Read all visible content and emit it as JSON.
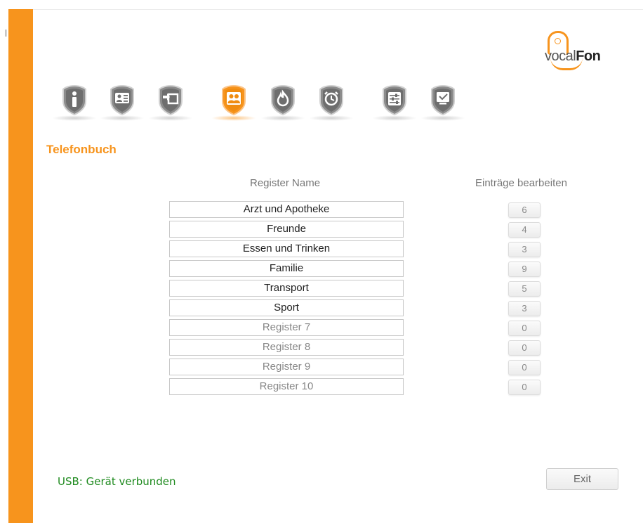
{
  "app": {
    "logo": {
      "text_light": "vocal",
      "text_bold": "Fon"
    },
    "accent_color": "#f7941d",
    "status_color": "#1e8a1e"
  },
  "nav": {
    "items": [
      {
        "icon": "info-icon",
        "active": false
      },
      {
        "icon": "contact-card-icon",
        "active": false
      },
      {
        "icon": "import-icon",
        "active": false
      },
      {
        "icon": "phonebook-icon",
        "active": true
      },
      {
        "icon": "emergency-icon",
        "active": false
      },
      {
        "icon": "alarm-clock-icon",
        "active": false
      },
      {
        "icon": "settings-sliders-icon",
        "active": false
      },
      {
        "icon": "display-icon",
        "active": false
      }
    ]
  },
  "section": {
    "title": "Telefonbuch"
  },
  "table": {
    "header_name": "Register Name",
    "header_edit": "Einträge bearbeiten",
    "rows": [
      {
        "name": "Arzt und Apotheke",
        "count": "6"
      },
      {
        "name": "Freunde",
        "count": "4"
      },
      {
        "name": "Essen und Trinken",
        "count": "3"
      },
      {
        "name": "Familie",
        "count": "9"
      },
      {
        "name": "Transport",
        "count": "5"
      },
      {
        "name": "Sport",
        "count": "3"
      },
      {
        "name": "Register 7",
        "count": "0"
      },
      {
        "name": "Register 8",
        "count": "0"
      },
      {
        "name": "Register 9",
        "count": "0"
      },
      {
        "name": "Register 10",
        "count": "0"
      }
    ]
  },
  "footer": {
    "status": "USB: Gerät verbunden",
    "exit_label": "Exit"
  }
}
